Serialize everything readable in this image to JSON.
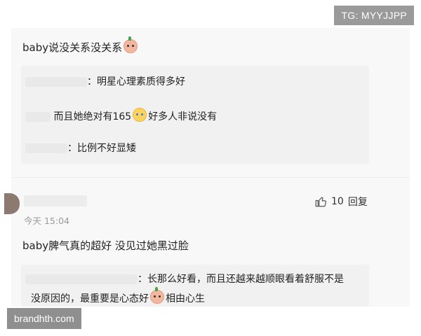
{
  "watermarks": {
    "top": "TG: MYYJJPP",
    "bottom": "brandhth.com"
  },
  "comment1": {
    "text": "baby说没关系没关系",
    "replies": [
      {
        "text": "：明星心理素质得多好"
      },
      {
        "text_a": "而且她绝对有165",
        "text_b": "好多人非说没有"
      },
      {
        "text": "：比例不好显矮"
      }
    ]
  },
  "comment2": {
    "time": "今天 15:04",
    "likes": "10",
    "reply_label": "回复",
    "text": "baby脾气真的超好 没见过她黑过脸",
    "replies": [
      {
        "line1": "：长那么好看，而且还越来越顺眼看着舒服不是",
        "line2_a": "没原因的，最重要是心态好",
        "line2_b": "相由心生"
      }
    ]
  }
}
